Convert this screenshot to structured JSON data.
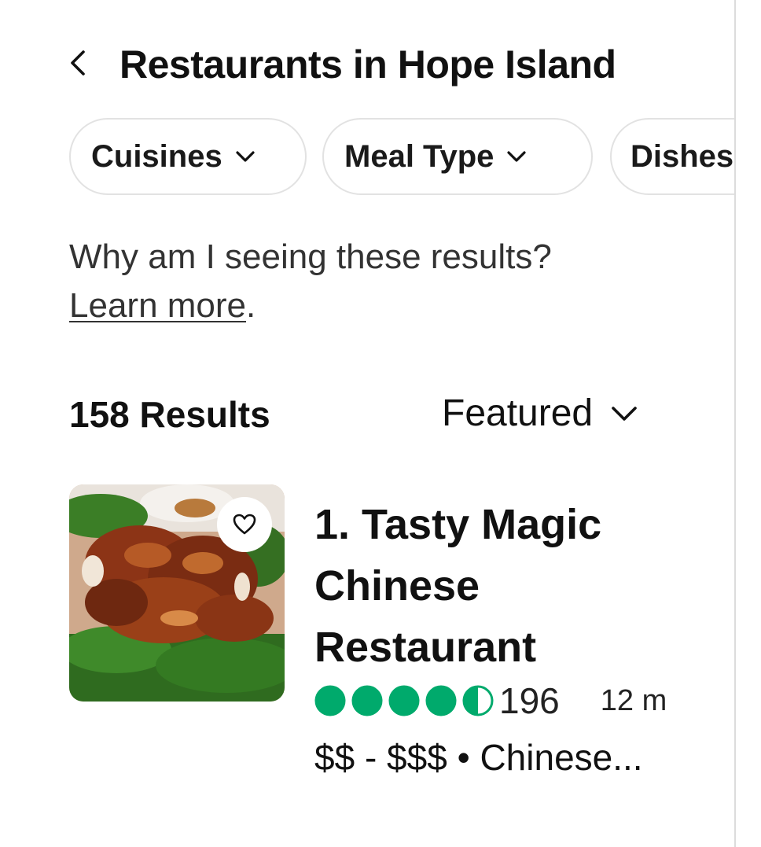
{
  "header": {
    "back_icon": "chevron-left-icon",
    "title": "Restaurants in Hope Island"
  },
  "filters": [
    {
      "label": "Cuisines",
      "icon": "chevron-down-icon"
    },
    {
      "label": "Meal Type",
      "icon": "chevron-down-icon"
    },
    {
      "label": "Dishes",
      "icon": "chevron-down-icon"
    }
  ],
  "info": {
    "question": "Why am I seeing these results?",
    "link": "Learn more",
    "link_suffix": "."
  },
  "results": {
    "count_label": "158 Results",
    "sort_label": "Featured",
    "sort_icon": "chevron-down-icon"
  },
  "listings": [
    {
      "name": "1. Tasty Magic Chinese Restaurant",
      "rating": 4.5,
      "rating_color": "#00aa6c",
      "review_count": "196",
      "distance": "12 m",
      "price_cuisine": "$$ - $$$ • Chinese...",
      "save_icon": "heart-outline-icon",
      "image": "roast-duck-photo"
    }
  ]
}
